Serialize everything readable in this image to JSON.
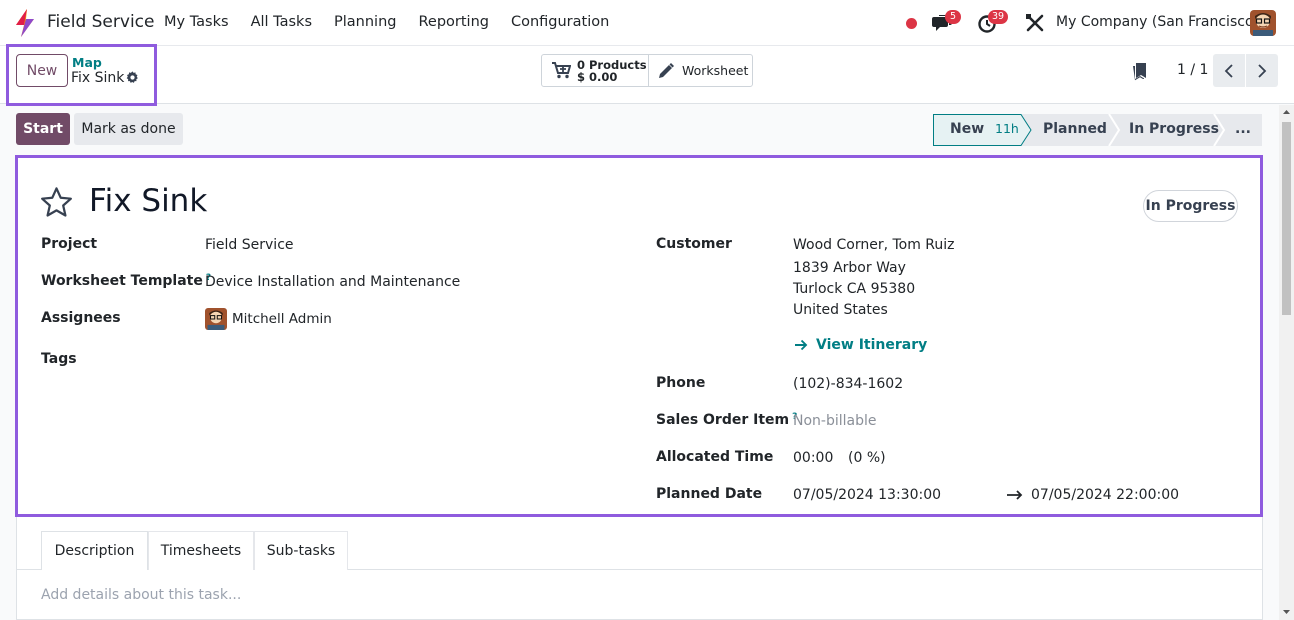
{
  "navbar": {
    "app_name": "Field Service",
    "menu": [
      "My Tasks",
      "All Tasks",
      "Planning",
      "Reporting",
      "Configuration"
    ],
    "messages_count": "5",
    "activities_count": "39",
    "company": "My Company (San Francisco)"
  },
  "control_panel": {
    "new_label": "New",
    "breadcrumb_parent": "Map",
    "breadcrumb_current": "Fix Sink",
    "products_count": "0 Products",
    "products_amount": "$ 0.00",
    "worksheet_label": "Worksheet",
    "pager": "1 / 1"
  },
  "statusbar": {
    "start_label": "Start",
    "mark_done_label": "Mark as done",
    "stages": [
      {
        "label": "New",
        "duration": "11h",
        "active": true
      },
      {
        "label": "Planned"
      },
      {
        "label": "In Progress"
      },
      {
        "label": "..."
      }
    ]
  },
  "form": {
    "title": "Fix Sink",
    "state": "In Progress",
    "left": {
      "project_label": "Project",
      "project_value": "Field Service",
      "worksheet_label": "Worksheet Template",
      "worksheet_help": "?",
      "worksheet_value": "Device Installation and Maintenance",
      "assignees_label": "Assignees",
      "assignees_value": "Mitchell Admin",
      "tags_label": "Tags"
    },
    "right": {
      "customer_label": "Customer",
      "customer_name": "Wood Corner, Tom Ruiz",
      "customer_street": "1839 Arbor Way",
      "customer_city": "Turlock CA 95380",
      "customer_country": "United States",
      "itinerary_label": "View Itinerary",
      "phone_label": "Phone",
      "phone_value": "(102)-834-1602",
      "sale_line_label": "Sales Order Item",
      "sale_line_help": "?",
      "sale_line_value": "Non-billable",
      "allocated_label": "Allocated Time",
      "allocated_value": "00:00",
      "allocated_percent": "(0 %)",
      "planned_label": "Planned Date",
      "planned_start": "07/05/2024 13:30:00",
      "planned_end": "07/05/2024 22:00:00"
    }
  },
  "notebook": {
    "tabs": [
      "Description",
      "Timesheets",
      "Sub-tasks"
    ],
    "description_placeholder": "Add details about this task..."
  },
  "colors": {
    "brand": "#714b67",
    "teal": "#017e84",
    "highlight": "#8f5bde",
    "badge": "#dc3545"
  }
}
